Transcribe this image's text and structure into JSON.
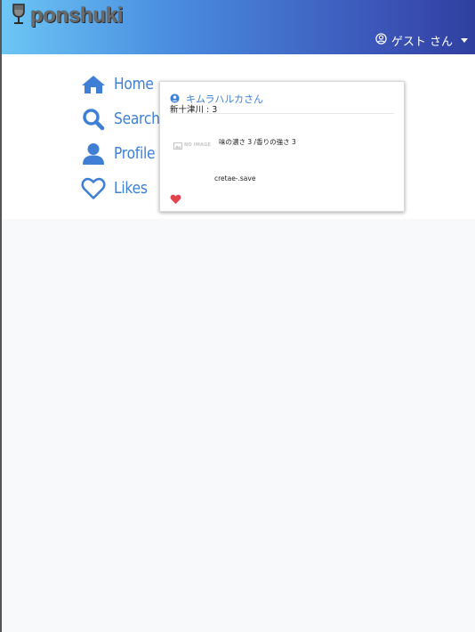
{
  "header": {
    "brand": "ponshuki",
    "user_menu_label": "ゲスト さん"
  },
  "sidenav": {
    "items": [
      {
        "label": "Home",
        "icon": "home-icon"
      },
      {
        "label": "Search",
        "icon": "search-icon"
      },
      {
        "label": "Profile",
        "icon": "user-icon"
      },
      {
        "label": "Likes",
        "icon": "heart-outline-icon"
      }
    ]
  },
  "post": {
    "user": "キムラハルカさん",
    "sake": "新十津川 : 3",
    "noimage_text": "NO IMAGE",
    "detail": "味の濃さ 3 /香りの強さ 3",
    "filename": "cretae-.save"
  },
  "colors": {
    "accent": "#3f80d6",
    "like": "#e0444f",
    "header_gradient_start": "#6cc6f5",
    "header_gradient_end": "#2f3f9f"
  }
}
